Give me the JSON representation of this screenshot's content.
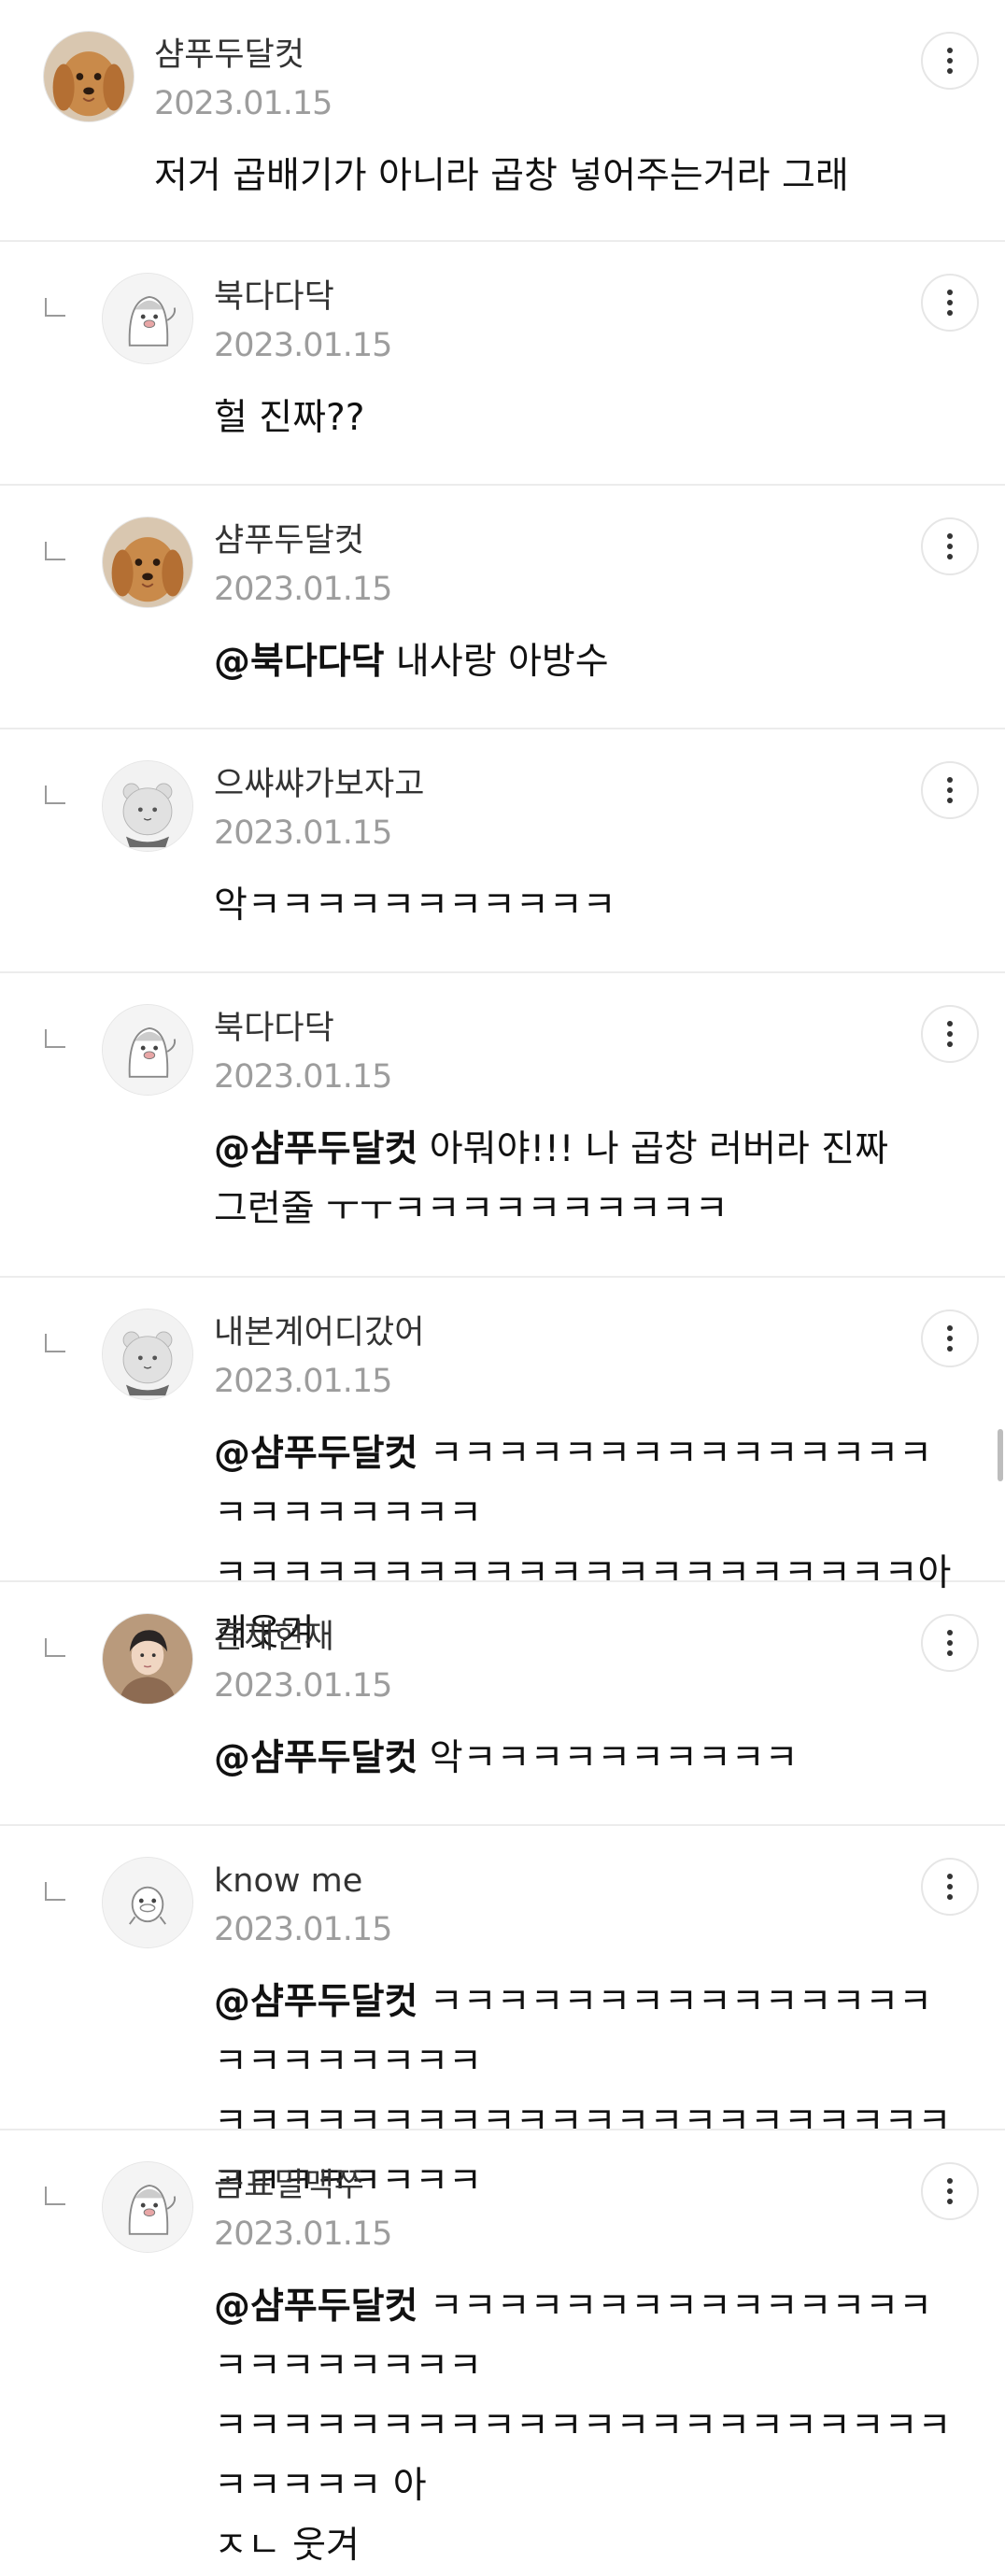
{
  "comments": [
    {
      "author": "샴푸두달컷",
      "date": "2023.01.15",
      "mention": "",
      "text": "저거 곱배기가 아니라 곱창 넣어주는거라 그래"
    },
    {
      "author": "북다다닥",
      "date": "2023.01.15",
      "mention": "",
      "text": "헐 진짜??"
    },
    {
      "author": "샴푸두달컷",
      "date": "2023.01.15",
      "mention": "@북다다닥",
      "text": " 내사랑 아방수"
    },
    {
      "author": "으쌰쌰가보자고",
      "date": "2023.01.15",
      "mention": "",
      "text": "악ㅋㅋㅋㅋㅋㅋㅋㅋㅋㅋㅋ"
    },
    {
      "author": "북다다닥",
      "date": "2023.01.15",
      "mention": "@샴푸두달컷",
      "text": " 아뭐야!!! 나 곱창 러버라 진짜\n그런줄 ㅜㅜㅋㅋㅋㅋㅋㅋㅋㅋㅋㅋ"
    },
    {
      "author": "내본계어디갔어",
      "date": "2023.01.15",
      "mention": "@샴푸두달컷",
      "text": " ㅋㅋㅋㅋㅋㅋㅋㅋㅋㅋㅋㅋㅋㅋㅋㅋㅋㅋㅋㅋㅋㅋㅋ\nㅋㅋㅋㅋㅋㅋㅋㅋㅋㅋㅋㅋㅋㅋㅋㅋㅋㅋㅋㅋㅋ아 개웃겨"
    },
    {
      "author": "흔재현재",
      "date": "2023.01.15",
      "mention": "@샴푸두달컷",
      "text": " 악ㅋㅋㅋㅋㅋㅋㅋㅋㅋㅋ"
    },
    {
      "author": "know me",
      "date": "2023.01.15",
      "mention": "@샴푸두달컷",
      "text": " ㅋㅋㅋㅋㅋㅋㅋㅋㅋㅋㅋㅋㅋㅋㅋㅋㅋㅋㅋㅋㅋㅋㅋ\nㅋㅋㅋㅋㅋㅋㅋㅋㅋㅋㅋㅋㅋㅋㅋㅋㅋㅋㅋㅋㅋㅋㅋㅋㅋㅋㅋㅋㅋㅋ"
    },
    {
      "author": "곰표밀맥쭈",
      "date": "2023.01.15",
      "mention": "@샴푸두달컷",
      "text": " ㅋㅋㅋㅋㅋㅋㅋㅋㅋㅋㅋㅋㅋㅋㅋㅋㅋㅋㅋㅋㅋㅋㅋ\nㅋㅋㅋㅋㅋㅋㅋㅋㅋㅋㅋㅋㅋㅋㅋㅋㅋㅋㅋㅋㅋㅋㅋㅋㅋㅋㅋ 아\nㅈㄴ 웃겨"
    }
  ],
  "avatars": [
    "dog-photo",
    "penguin-icon",
    "dog-photo",
    "bear-icon",
    "penguin-icon",
    "bear-icon",
    "person-photo",
    "character-icon",
    "penguin-icon"
  ],
  "colors": {
    "divider": "#ececec",
    "date": "#9d9d9d",
    "author": "#333333"
  }
}
